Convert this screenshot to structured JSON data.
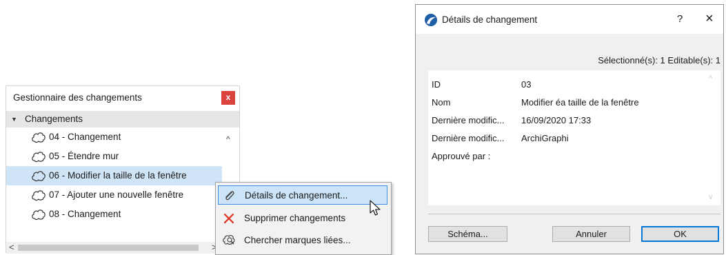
{
  "change_manager": {
    "title": "Gestionnaire des changements",
    "close_label": "x",
    "header_label": "Changements",
    "items": [
      {
        "label": "04 - Changement"
      },
      {
        "label": "05 - Étendre mur"
      },
      {
        "label": "06 - Modifier la taille de la fenêtre",
        "selected": true
      },
      {
        "label": "07 - Ajouter une nouvelle fenêtre"
      },
      {
        "label": "08 - Changement"
      }
    ]
  },
  "context_menu": {
    "items": [
      {
        "label": "Détails de changement...",
        "icon": "paperclip-icon",
        "highlighted": true
      },
      {
        "label": "Supprimer changements",
        "icon": "delete-x-icon"
      },
      {
        "label": "Chercher marques liées...",
        "icon": "find-marker-icon"
      }
    ]
  },
  "dialog": {
    "title": "Détails de changement",
    "help_label": "?",
    "close_label": "×",
    "counts": "Sélectionné(s): 1 Editable(s): 1",
    "properties": [
      {
        "label": "ID",
        "value": "03"
      },
      {
        "label": "Nom",
        "value": "Modifier éa taille de la fenêtre"
      },
      {
        "label": "Dernière modific...",
        "value": "16/09/2020 17:33"
      },
      {
        "label": "Dernière modific...",
        "value": "ArchiGraphi"
      },
      {
        "label": "Approuvé par :",
        "value": ""
      }
    ],
    "buttons": {
      "schema": "Schéma...",
      "cancel": "Annuler",
      "ok": "OK"
    }
  },
  "colors": {
    "selection": "#cfe4f6",
    "close_red": "#d9433b",
    "menu_highlight_border": "#3d8ee0",
    "ok_border": "#0078d7"
  }
}
